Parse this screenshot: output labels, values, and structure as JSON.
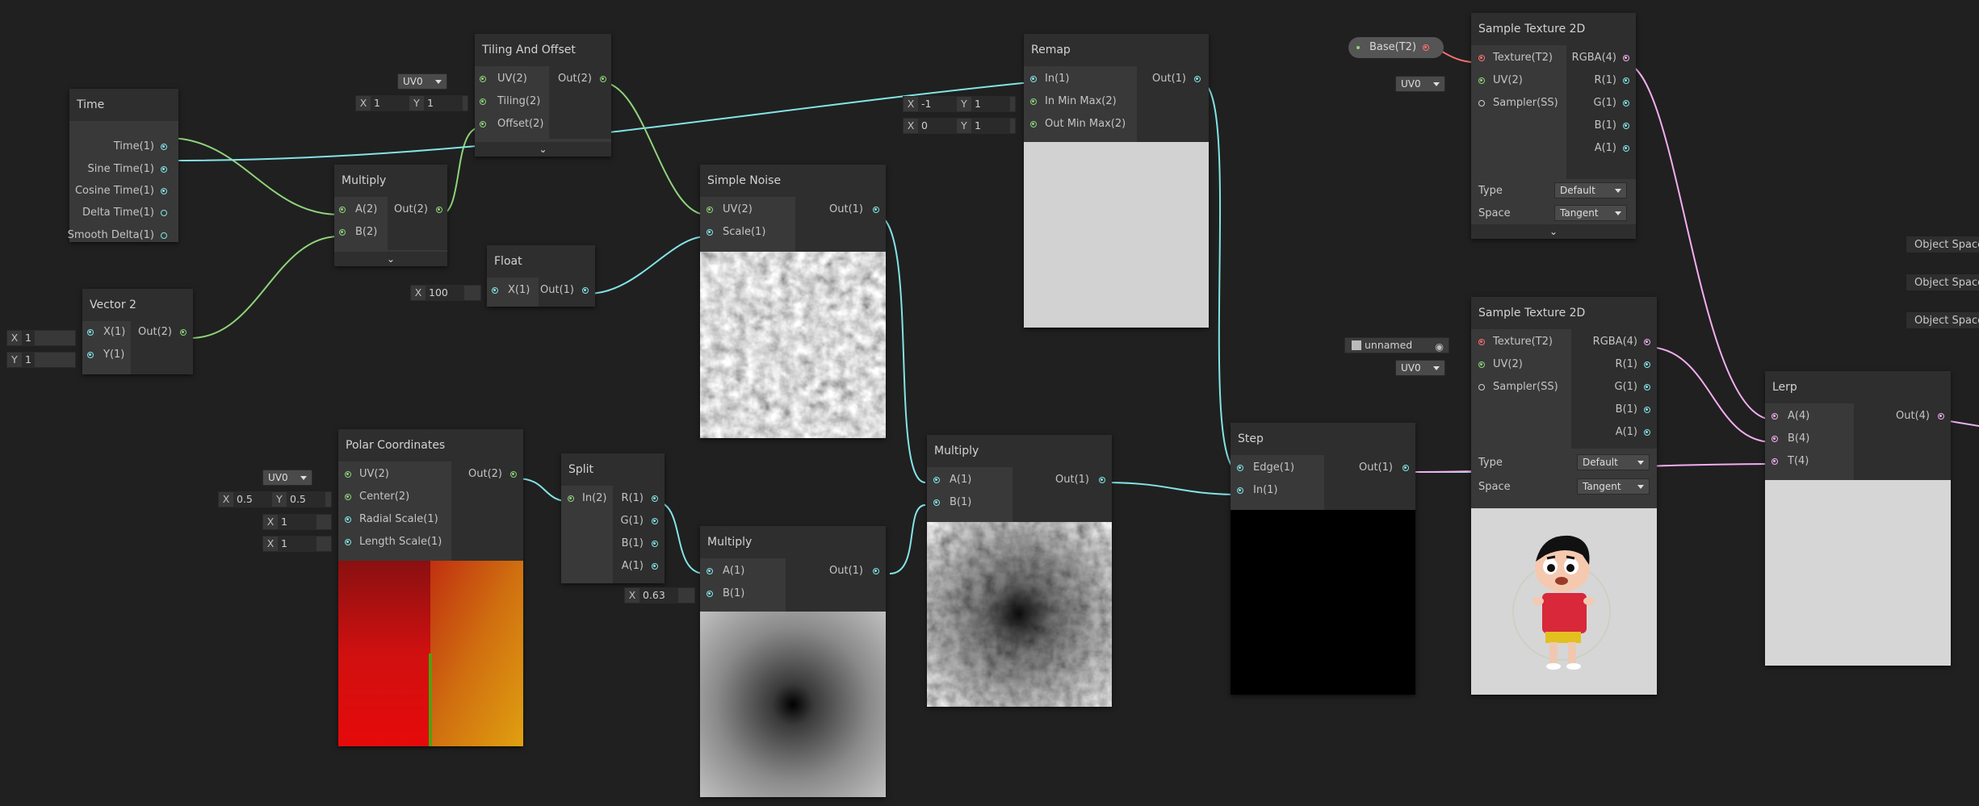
{
  "colors": {
    "background": "#202020",
    "node": "#393939",
    "header": "#2e2e2e",
    "vector": "#84e4e7",
    "vector2": "#8fd47a",
    "vector4": "#f3aef0",
    "texture": "#ff7070"
  },
  "nodes": {
    "time": {
      "title": "Time",
      "outputs": [
        "Time(1)",
        "Sine Time(1)",
        "Cosine Time(1)",
        "Delta Time(1)",
        "Smooth Delta(1)"
      ]
    },
    "vector2": {
      "title": "Vector 2",
      "inputs": [
        "X(1)",
        "Y(1)"
      ],
      "outputs": [
        "Out(2)"
      ],
      "x": "1",
      "y": "1",
      "xl": "X",
      "yl": "Y"
    },
    "multiply1": {
      "title": "Multiply",
      "inputs": [
        "A(2)",
        "B(2)"
      ],
      "outputs": [
        "Out(2)"
      ]
    },
    "tiling": {
      "title": "Tiling And Offset",
      "inputs": [
        "UV(2)",
        "Tiling(2)",
        "Offset(2)"
      ],
      "outputs": [
        "Out(2)"
      ],
      "uv": "UV0",
      "tx": "1",
      "ty": "1"
    },
    "float": {
      "title": "Float",
      "inputs": [
        "X(1)"
      ],
      "outputs": [
        "Out(1)"
      ],
      "x": "100"
    },
    "noise": {
      "title": "Simple Noise",
      "inputs": [
        "UV(2)",
        "Scale(1)"
      ],
      "outputs": [
        "Out(1)"
      ]
    },
    "remap": {
      "title": "Remap",
      "inputs": [
        "In(1)",
        "In Min Max(2)",
        "Out Min Max(2)"
      ],
      "outputs": [
        "Out(1)"
      ],
      "inx": "-1",
      "iny": "1",
      "outx": "0",
      "outy": "1"
    },
    "polar": {
      "title": "Polar Coordinates",
      "inputs": [
        "UV(2)",
        "Center(2)",
        "Radial Scale(1)",
        "Length Scale(1)"
      ],
      "outputs": [
        "Out(2)"
      ],
      "uv": "UV0",
      "cx": "0.5",
      "cy": "0.5",
      "radial": "1",
      "length": "1"
    },
    "split": {
      "title": "Split",
      "inputs": [
        "In(2)"
      ],
      "outputs": [
        "R(1)",
        "G(1)",
        "B(1)",
        "A(1)"
      ]
    },
    "multiply2": {
      "title": "Multiply",
      "inputs": [
        "A(1)",
        "B(1)"
      ],
      "outputs": [
        "Out(1)"
      ],
      "b": "0.63"
    },
    "multiply3": {
      "title": "Multiply",
      "inputs": [
        "A(1)",
        "B(1)"
      ],
      "outputs": [
        "Out(1)"
      ]
    },
    "step": {
      "title": "Step",
      "inputs": [
        "Edge(1)",
        "In(1)"
      ],
      "outputs": [
        "Out(1)"
      ]
    },
    "tex1": {
      "title": "Sample Texture 2D",
      "inputs": [
        "Texture(T2)",
        "UV(2)",
        "Sampler(SS)"
      ],
      "outputs": [
        "RGBA(4)",
        "R(1)",
        "G(1)",
        "B(1)",
        "A(1)"
      ],
      "type_label": "Type",
      "type": "Default",
      "space_label": "Space",
      "space": "Tangent",
      "uv": "UV0"
    },
    "tex2": {
      "title": "Sample Texture 2D",
      "inputs": [
        "Texture(T2)",
        "UV(2)",
        "Sampler(SS)"
      ],
      "outputs": [
        "RGBA(4)",
        "R(1)",
        "G(1)",
        "B(1)",
        "A(1)"
      ],
      "type_label": "Type",
      "type": "Default",
      "space_label": "Space",
      "space": "Tangent",
      "uv": "UV0",
      "texture": "unnamed"
    },
    "lerp": {
      "title": "Lerp",
      "inputs": [
        "A(4)",
        "B(4)",
        "T(4)"
      ],
      "outputs": [
        "Out(4)"
      ]
    }
  },
  "base_property": "Base(T2)",
  "object_space": [
    "Object Space",
    "Object Space",
    "Object Space"
  ],
  "labels": {
    "x": "X",
    "y": "Y"
  }
}
